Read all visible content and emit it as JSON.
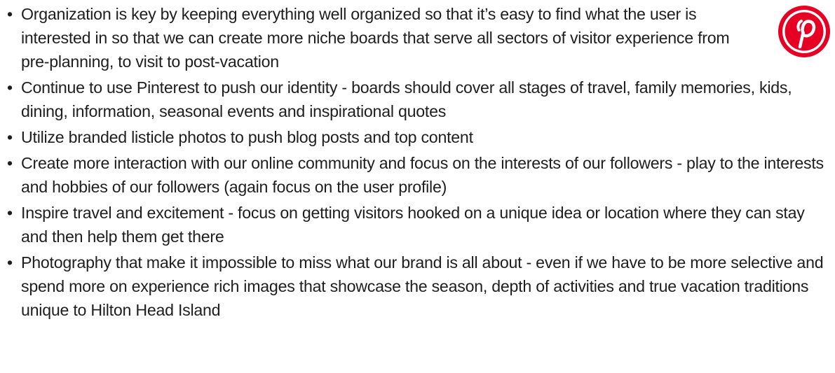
{
  "brand": {
    "logo_icon": "pinterest-logo-icon",
    "accent_color": "#e60023"
  },
  "bullets": [
    {
      "text": "Organization is key by keeping everything well organized so that it’s easy to find what the user is interested in so that we can create more niche boards that serve all sectors of visitor experience from pre-planning, to visit to post-vacation"
    },
    {
      "text": "Continue to use Pinterest to push our identity - boards should cover all stages of travel, family memories, kids, dining, information, seasonal events and inspirational quotes"
    },
    {
      "text": "Utilize branded listicle photos to push blog posts and top content"
    },
    {
      "text": "Create more interaction with our online community and focus on the interests of our followers - play to the interests and hobbies of our followers (again focus on the user profile)"
    },
    {
      "text": "Inspire travel and excitement - focus on getting visitors hooked on a unique idea or location where they can stay and then help them get there"
    },
    {
      "text": "Photography that make it impossible to miss what our brand is all about - even if we have to be more selective and spend more on experience rich images that showcase the season, depth of activities and true vacation traditions unique to Hilton Head Island"
    }
  ]
}
